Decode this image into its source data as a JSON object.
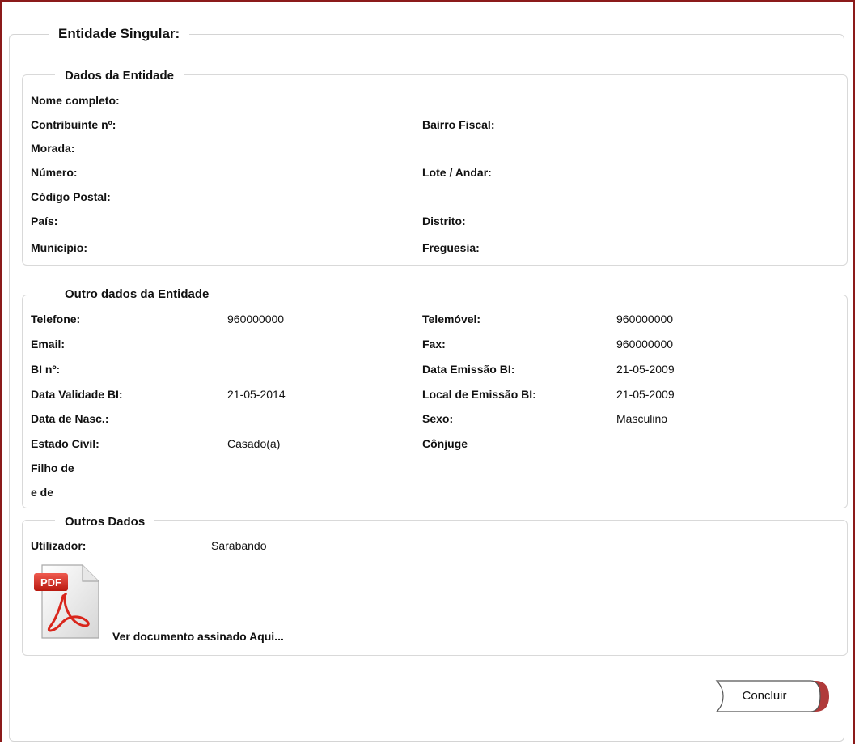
{
  "title": "Entidade Singular:",
  "sections": {
    "dados": {
      "legend": "Dados da Entidade",
      "fields": [
        {
          "label": "Nome completo:"
        },
        {
          "label": "Contribuinte nº:"
        },
        {
          "label": "Bairro Fiscal:"
        },
        {
          "label": "Morada:"
        },
        {
          "label": "Número:"
        },
        {
          "label": "Lote / Andar:"
        },
        {
          "label": "Código Postal:"
        },
        {
          "label": "País:"
        },
        {
          "label": "Distrito:"
        },
        {
          "label": "Município:"
        },
        {
          "label": "Freguesia:"
        }
      ]
    },
    "outros_entidade": {
      "legend": "Outro dados da Entidade",
      "fields": [
        {
          "label": "Telefone:",
          "value": "960000000"
        },
        {
          "label": "Telemóvel:",
          "value": "960000000"
        },
        {
          "label": "Email:",
          "value": ""
        },
        {
          "label": "Fax:",
          "value": "960000000"
        },
        {
          "label": "BI nº:",
          "value": ""
        },
        {
          "label": "Data Emissão BI:",
          "value": "21-05-2009"
        },
        {
          "label": "Data Validade BI:",
          "value": "21-05-2014"
        },
        {
          "label": "Local de Emissão BI:",
          "value": "21-05-2009"
        },
        {
          "label": "Data de Nasc.:",
          "value": ""
        },
        {
          "label": "Sexo:",
          "value": "Masculino"
        },
        {
          "label": "Estado Civil:",
          "value": "Casado(a)"
        },
        {
          "label": "Cônjuge",
          "value": ""
        },
        {
          "label": "Filho de",
          "value": ""
        },
        {
          "label": "e de",
          "value": ""
        }
      ]
    },
    "outros_dados": {
      "legend": "Outros Dados",
      "utilizador_label": "Utilizador:",
      "utilizador_value": "Sarabando",
      "pdf_badge": "PDF",
      "pdf_icon": "pdf-file-icon",
      "pdf_link": "Ver documento assinado Aqui..."
    }
  },
  "button": {
    "label": "Concluir"
  },
  "colors": {
    "frame": "#8b1a1a",
    "button_accent": "#b03a3a",
    "pdf_red": "#d9261c"
  }
}
